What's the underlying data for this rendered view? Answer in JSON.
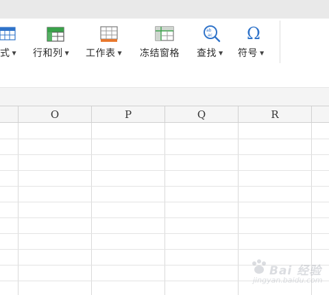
{
  "ribbon": {
    "tools": [
      {
        "label": "式",
        "has_dropdown": true,
        "icon": "cell-format-icon"
      },
      {
        "label": "行和列",
        "has_dropdown": true,
        "icon": "rows-columns-icon"
      },
      {
        "label": "工作表",
        "has_dropdown": true,
        "icon": "worksheet-icon"
      },
      {
        "label": "冻结窗格",
        "has_dropdown": false,
        "icon": "freeze-panes-icon"
      },
      {
        "label": "查找",
        "has_dropdown": true,
        "icon": "find-icon"
      },
      {
        "label": "符号",
        "has_dropdown": true,
        "icon": "symbol-omega-icon"
      }
    ],
    "colors": {
      "accent_blue": "#2f73c9",
      "accent_green": "#3aa24a",
      "accent_orange": "#e8782e"
    }
  },
  "sheet": {
    "columns": [
      "O",
      "P",
      "Q",
      "R"
    ]
  },
  "watermark": {
    "text": "Bai 经验",
    "sub": "jingyan.baidu.com"
  }
}
